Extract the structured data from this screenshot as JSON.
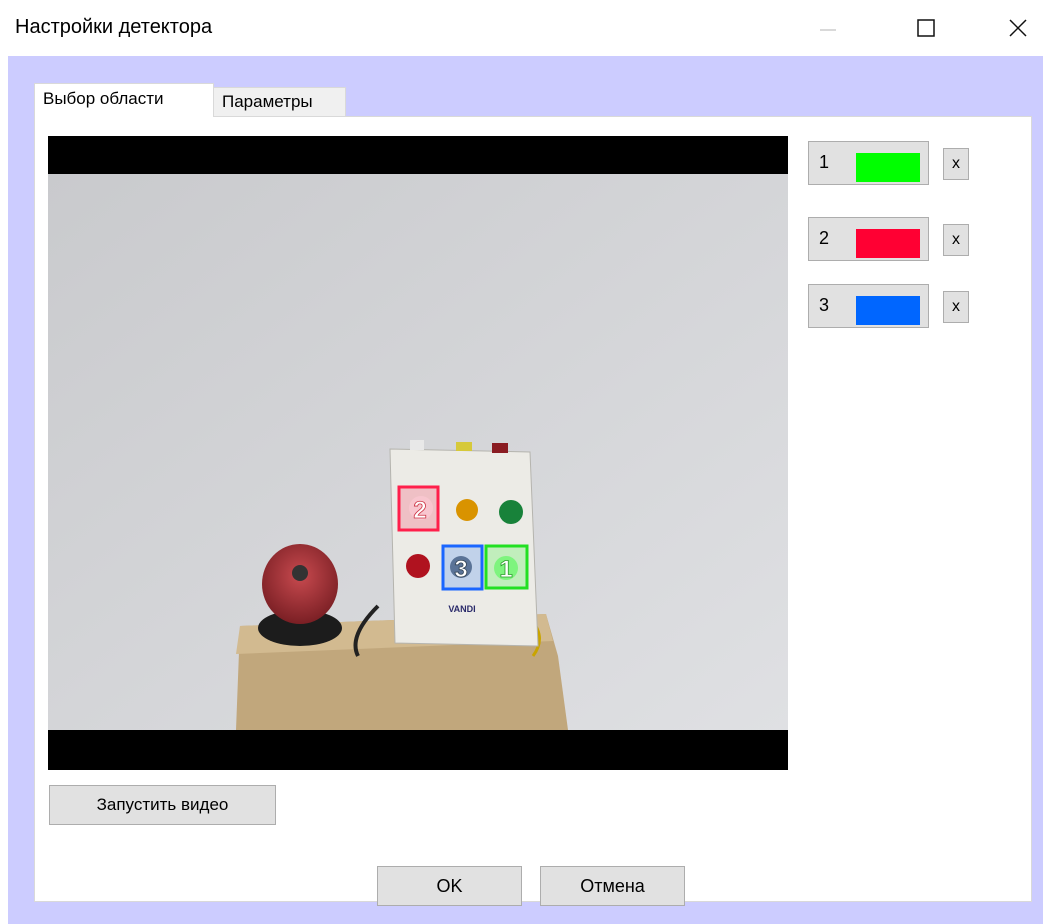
{
  "window": {
    "title": "Настройки детектора"
  },
  "tabs": [
    {
      "label": "Выбор области",
      "active": true
    },
    {
      "label": "Параметры",
      "active": false
    }
  ],
  "video": {
    "start_button_label": "Запустить видео",
    "device_brand": "VANDI",
    "region_labels": [
      "1",
      "2",
      "3"
    ]
  },
  "zones": [
    {
      "number": "1",
      "color": "#00ff00",
      "delete_label": "x"
    },
    {
      "number": "2",
      "color": "#ff0033",
      "delete_label": "x"
    },
    {
      "number": "3",
      "color": "#0066ff",
      "delete_label": "x"
    }
  ],
  "footer": {
    "ok_label": "OK",
    "cancel_label": "Отмена"
  },
  "icons": {
    "minimize": "minimize-icon",
    "maximize": "maximize-icon",
    "close": "close-icon"
  }
}
